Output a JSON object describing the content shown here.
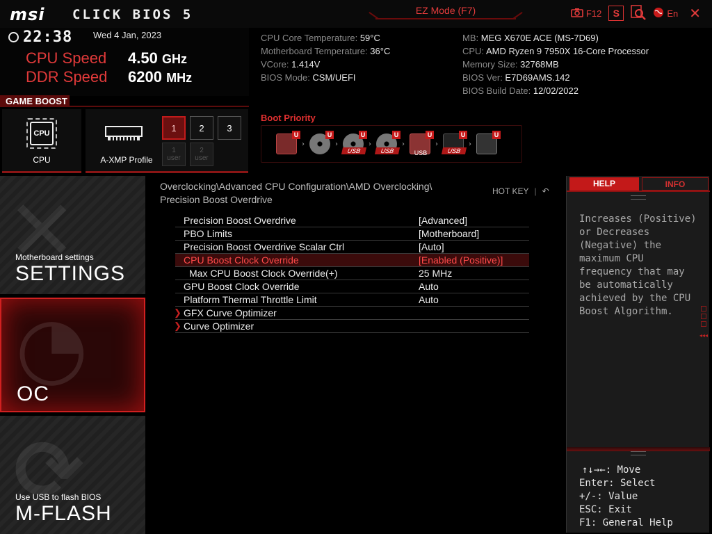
{
  "topbar": {
    "logo": "msi",
    "product": "CLICK BIOS 5",
    "ez_mode": "EZ Mode (F7)",
    "screenshot_key": "F12",
    "s_button": "S",
    "language": "En",
    "icons": [
      "camera-icon",
      "search-icon",
      "globe-icon",
      "close-icon"
    ]
  },
  "clock": {
    "time": "22:38",
    "date": "Wed  4 Jan, 2023"
  },
  "speed": {
    "cpu_label": "CPU Speed",
    "cpu_value": "4.50",
    "cpu_unit": "GHz",
    "ddr_label": "DDR Speed",
    "ddr_value": "6200",
    "ddr_unit": "MHz"
  },
  "sysinfo_left": [
    {
      "label": "CPU Core Temperature: ",
      "value": "59°C"
    },
    {
      "label": "Motherboard Temperature: ",
      "value": "36°C"
    },
    {
      "label": "VCore: ",
      "value": "1.414V"
    },
    {
      "label": "BIOS Mode: ",
      "value": "CSM/UEFI"
    }
  ],
  "sysinfo_right": [
    {
      "label": "MB: ",
      "value": "MEG X670E ACE (MS-7D69)"
    },
    {
      "label": "CPU: ",
      "value": "AMD Ryzen 9 7950X 16-Core Processor"
    },
    {
      "label": "Memory Size: ",
      "value": "32768MB"
    },
    {
      "label": "BIOS Ver: ",
      "value": "E7D69AMS.142"
    },
    {
      "label": "BIOS Build Date: ",
      "value": "12/02/2022"
    }
  ],
  "game_boost": {
    "title": "GAME BOOST",
    "cpu_label": "CPU",
    "cpu_chip_text": "CPU",
    "xmp_label": "A-XMP Profile",
    "profiles": [
      "1",
      "2",
      "3"
    ],
    "user_profiles": [
      {
        "num": "1",
        "text": "user"
      },
      {
        "num": "2",
        "text": "user"
      }
    ]
  },
  "boot_priority": {
    "title": "Boot Priority",
    "badge": "U",
    "devices": [
      {
        "icon": "hdd-icon",
        "label": ""
      },
      {
        "icon": "optical-disc-icon",
        "label": ""
      },
      {
        "icon": "usb-disc-icon",
        "label": "USB"
      },
      {
        "icon": "usb-disc-icon",
        "label": "USB"
      },
      {
        "icon": "usb-key-icon",
        "label": "USB"
      },
      {
        "icon": "usb-floppy-icon",
        "label": "USB"
      },
      {
        "icon": "network-icon",
        "label": ""
      }
    ]
  },
  "nav": {
    "settings_sub": "Motherboard settings",
    "settings_title": "SETTINGS",
    "oc_title": "OC",
    "mflash_sub": "Use USB to flash BIOS",
    "mflash_title": "M-FLASH"
  },
  "main": {
    "breadcrumb": "Overclocking\\Advanced CPU Configuration\\AMD Overclocking\\ Precision Boost Overdrive",
    "hotkey": "HOT KEY",
    "hotkey_sep": "|",
    "back_icon": "↶",
    "rows": [
      {
        "label": "Precision Boost Overdrive",
        "value": "[Advanced]"
      },
      {
        "label": "PBO Limits",
        "value": "[Motherboard]"
      },
      {
        "label": "Precision Boost Overdrive Scalar Ctrl",
        "value": "[Auto]"
      },
      {
        "label": "CPU Boost Clock Override",
        "value": "[Enabled (Positive)]"
      },
      {
        "label": "Max CPU Boost Clock Override(+)",
        "value": "25 MHz"
      },
      {
        "label": "GPU Boost Clock Override",
        "value": "Auto"
      },
      {
        "label": "Platform Thermal Throttle Limit",
        "value": "Auto"
      },
      {
        "label": "GFX Curve Optimizer",
        "value": ""
      },
      {
        "label": "Curve Optimizer",
        "value": ""
      }
    ]
  },
  "help": {
    "tab_help": "HELP",
    "tab_info": "INFO",
    "text": "Increases (Positive) or Decreases (Negative) the maximum CPU frequency that may be automatically achieved by the CPU Boost Algorithm.",
    "keys": [
      "↑↓→←: Move",
      "Enter: Select",
      "+/-: Value",
      "ESC: Exit",
      "F1: General Help"
    ]
  },
  "colors": {
    "accent": "#d12020",
    "selected_text": "#ff4a4a",
    "label_grey": "#8a8a8a"
  }
}
